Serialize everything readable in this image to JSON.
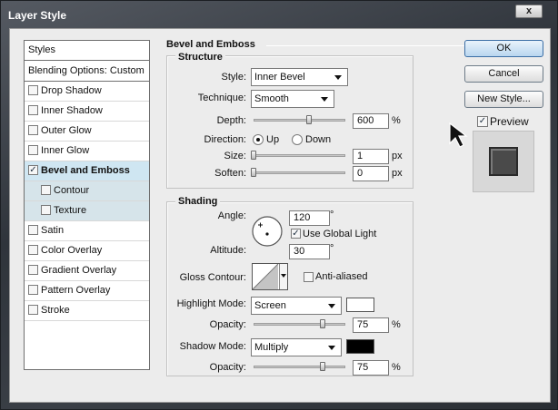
{
  "window": {
    "title": "Layer Style",
    "close_label": "x"
  },
  "styles_panel": {
    "header": "Styles",
    "items": [
      {
        "label": "Blending Options: Custom",
        "checkbox": false,
        "checked": false,
        "bold": false,
        "sub": false,
        "selected": false
      },
      {
        "label": "Drop Shadow",
        "checkbox": true,
        "checked": false,
        "bold": false,
        "sub": false,
        "selected": false
      },
      {
        "label": "Inner Shadow",
        "checkbox": true,
        "checked": false,
        "bold": false,
        "sub": false,
        "selected": false
      },
      {
        "label": "Outer Glow",
        "checkbox": true,
        "checked": false,
        "bold": false,
        "sub": false,
        "selected": false
      },
      {
        "label": "Inner Glow",
        "checkbox": true,
        "checked": false,
        "bold": false,
        "sub": false,
        "selected": false
      },
      {
        "label": "Bevel and Emboss",
        "checkbox": true,
        "checked": true,
        "bold": true,
        "sub": false,
        "selected": true
      },
      {
        "label": "Contour",
        "checkbox": true,
        "checked": false,
        "bold": false,
        "sub": true,
        "selected": false
      },
      {
        "label": "Texture",
        "checkbox": true,
        "checked": false,
        "bold": false,
        "sub": true,
        "selected": false
      },
      {
        "label": "Satin",
        "checkbox": true,
        "checked": false,
        "bold": false,
        "sub": false,
        "selected": false
      },
      {
        "label": "Color Overlay",
        "checkbox": true,
        "checked": false,
        "bold": false,
        "sub": false,
        "selected": false
      },
      {
        "label": "Gradient Overlay",
        "checkbox": true,
        "checked": false,
        "bold": false,
        "sub": false,
        "selected": false
      },
      {
        "label": "Pattern Overlay",
        "checkbox": true,
        "checked": false,
        "bold": false,
        "sub": false,
        "selected": false
      },
      {
        "label": "Stroke",
        "checkbox": true,
        "checked": false,
        "bold": false,
        "sub": false,
        "selected": false
      }
    ]
  },
  "bevel": {
    "section_title": "Bevel and Emboss",
    "structure_title": "Structure",
    "style_label": "Style:",
    "style_value": "Inner Bevel",
    "technique_label": "Technique:",
    "technique_value": "Smooth",
    "depth_label": "Depth:",
    "depth_value": "600",
    "depth_unit": "%",
    "depth_slider": 0.6,
    "direction_label": "Direction:",
    "direction_up": "Up",
    "direction_down": "Down",
    "direction_selected": "Up",
    "size_label": "Size:",
    "size_value": "1",
    "size_unit": "px",
    "size_slider": 0.0,
    "soften_label": "Soften:",
    "soften_value": "0",
    "soften_unit": "px",
    "soften_slider": 0.0
  },
  "shading": {
    "title": "Shading",
    "angle_label": "Angle:",
    "angle_value": "120",
    "angle_unit": "°",
    "global_light_label": "Use Global Light",
    "global_light_checked": true,
    "altitude_label": "Altitude:",
    "altitude_value": "30",
    "altitude_unit": "°",
    "gloss_label": "Gloss Contour:",
    "anti_alias_label": "Anti-aliased",
    "anti_alias_checked": false,
    "highlight_mode_label": "Highlight Mode:",
    "highlight_mode_value": "Screen",
    "highlight_color": "#ffffff",
    "highlight_opacity_label": "Opacity:",
    "highlight_opacity_value": "75",
    "highlight_opacity_unit": "%",
    "highlight_opacity_slider": 0.75,
    "shadow_mode_label": "Shadow Mode:",
    "shadow_mode_value": "Multiply",
    "shadow_color": "#000000",
    "shadow_opacity_label": "Opacity:",
    "shadow_opacity_value": "75",
    "shadow_opacity_unit": "%",
    "shadow_opacity_slider": 0.75
  },
  "actions": {
    "ok_label": "OK",
    "cancel_label": "Cancel",
    "new_style_label": "New Style...",
    "preview_label": "Preview",
    "preview_checked": true
  },
  "colors": {
    "selected_row": "#cfe6f2",
    "sub_row": "#d6e4ea"
  },
  "icons": [
    "close-icon",
    "checkmark-icon",
    "dropdown-arrow-icon",
    "angle-dial-icon",
    "gloss-contour-icon",
    "mouse-cursor-icon"
  ]
}
